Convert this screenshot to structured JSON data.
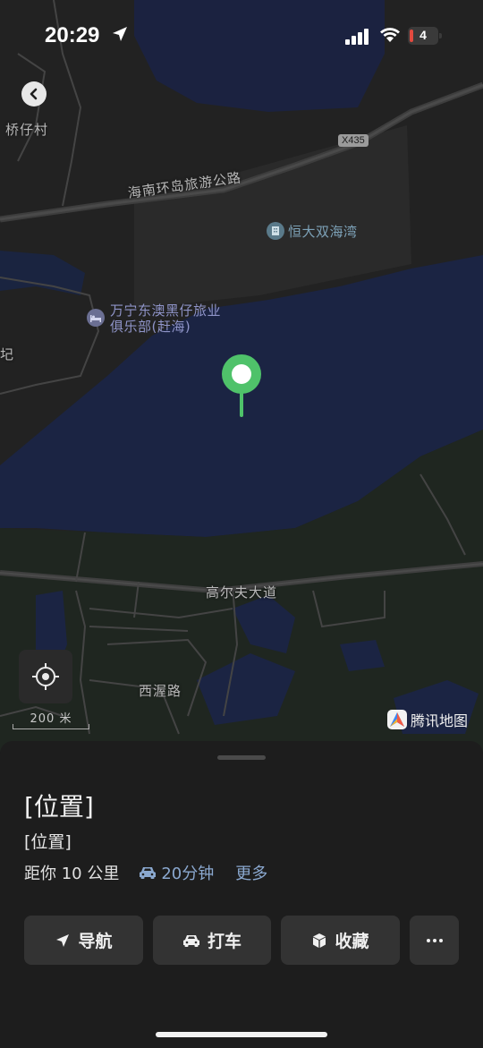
{
  "status_bar": {
    "time": "20:29",
    "battery_level": "4",
    "battery_color": "#e34a3f"
  },
  "map": {
    "labels": {
      "village": "桥仔村",
      "road_shield": "X435",
      "coastal_road": "海南环岛旅游公路",
      "resort": "恒大双海湾",
      "club_line1": "万宁东澳黑仔旅业",
      "club_line2": "俱乐部(赶海)",
      "edge_char": "圮",
      "golf_road": "高尔夫大道",
      "west_road": "西渥路"
    },
    "scale": "200 米",
    "brand": "腾讯地图",
    "pin_color": "#4fc26a",
    "water_color": "#1b2542",
    "land_color": "#212121",
    "green_color": "#1f2620"
  },
  "sheet": {
    "title": "[位置]",
    "subtitle": "[位置]",
    "distance": "距你 10 公里",
    "drive_time": "20分钟",
    "more_link": "更多",
    "buttons": {
      "navigate": "导航",
      "taxi": "打车",
      "favorite": "收藏"
    }
  },
  "icons": {
    "back": "chevron-left-icon",
    "location_arrow": "location-arrow-icon",
    "locate": "crosshair-icon",
    "car": "car-icon",
    "navigate": "navigation-arrow-icon",
    "taxi": "car-icon",
    "favorite": "box-icon",
    "more": "ellipsis-icon"
  }
}
